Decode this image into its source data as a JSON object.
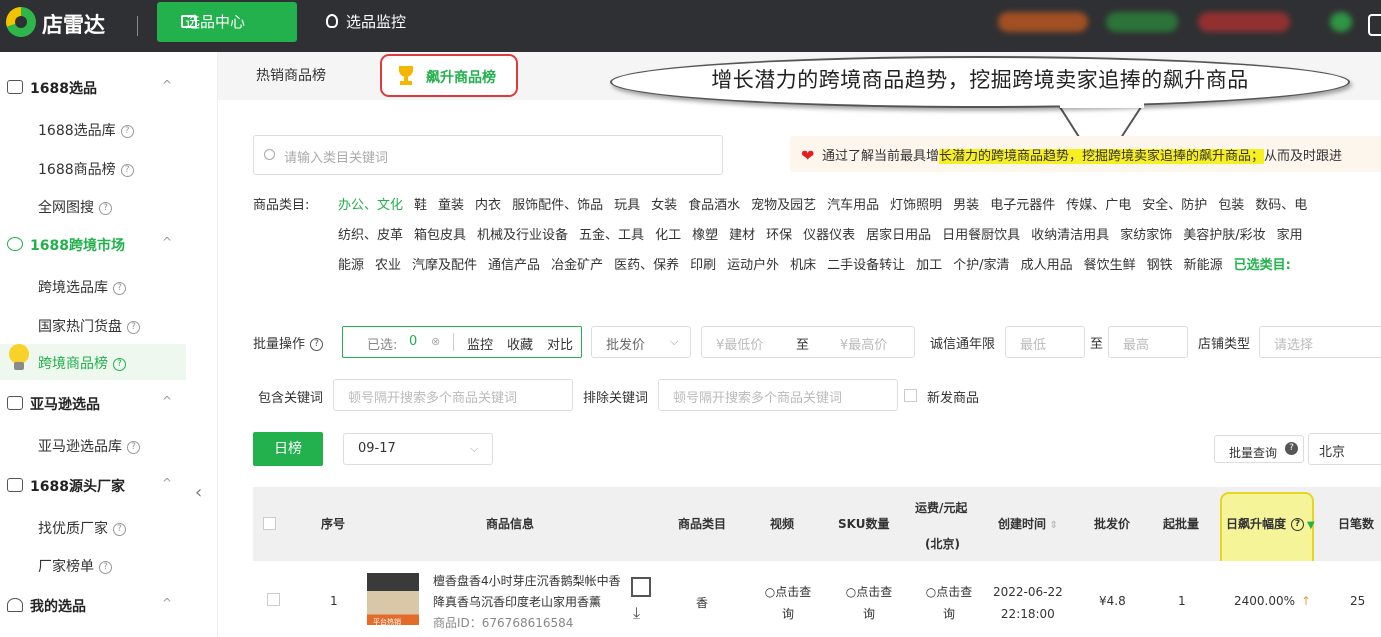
{
  "app": {
    "logo": "店雷达"
  },
  "topnav": {
    "selection_center": "选品中心",
    "monitor": "选品监控"
  },
  "sidebar": {
    "g1": "1688选品",
    "g1_items": [
      "1688选品库",
      "1688商品榜",
      "全网图搜"
    ],
    "g2": "1688跨境市场",
    "g2_items": [
      "跨境选品库",
      "国家热门货盘",
      "跨境商品榜"
    ],
    "g3": "亚马逊选品",
    "g3_items": [
      "亚马逊选品库"
    ],
    "g4": "1688源头厂家",
    "g4_items": [
      "找优质厂家",
      "厂家榜单"
    ],
    "g5": "我的选品",
    "q": "?",
    "caret": "^"
  },
  "tabs": {
    "hot": "热销商品榜",
    "rising": "飙升商品榜"
  },
  "callout": "增长潜力的跨境商品趋势，挖掘跨境卖家追捧的飙升商品",
  "search": {
    "placeholder": "请输入类目关键词"
  },
  "notice": {
    "pre": "通过了解当前最具增",
    "hl": "长潜力的跨境商品趋势，挖掘跨境卖家追捧的飙升商品；",
    "post": "从而及时跟进"
  },
  "categories": {
    "label": "商品类目:",
    "row1": [
      "办公、文化",
      "鞋",
      "童装",
      "内衣",
      "服饰配件、饰品",
      "玩具",
      "女装",
      "食品酒水",
      "宠物及园艺",
      "汽车用品",
      "灯饰照明",
      "男装",
      "电子元器件",
      "传媒、广电",
      "安全、防护",
      "包装",
      "数码、电"
    ],
    "row2": [
      "纺织、皮革",
      "箱包皮具",
      "机械及行业设备",
      "五金、工具",
      "化工",
      "橡塑",
      "建材",
      "环保",
      "仪器仪表",
      "居家日用品",
      "日用餐厨饮具",
      "收纳清洁用具",
      "家纺家饰",
      "美容护肤/彩妆",
      "家用"
    ],
    "row3": [
      "能源",
      "农业",
      "汽摩及配件",
      "通信产品",
      "冶金矿产",
      "医药、保养",
      "印刷",
      "运动户外",
      "机床",
      "二手设备转让",
      "加工",
      "个护/家清",
      "成人用品",
      "餐饮生鲜",
      "钢铁",
      "新能源"
    ],
    "selected_label": "已选类目:"
  },
  "filters": {
    "batch_label": "批量操作",
    "selected": "已选:",
    "selected_count": "0",
    "monitor": "监控",
    "collect": "收藏",
    "compare": "对比",
    "price_type": "批发价",
    "min_price": "¥最低价",
    "to": "至",
    "max_price": "¥最高价",
    "years_label": "诚信通年限",
    "min": "最低",
    "max": "最高",
    "shop_type": "店铺类型",
    "choose": "请选择",
    "include_kw": "包含关键词",
    "exclude_kw": "排除关键词",
    "kw_placeholder": "顿号隔开搜索多个商品关键词",
    "new_goods": "新发商品"
  },
  "list": {
    "day_btn": "日榜",
    "date": "09-17",
    "batch_query": "批量查询",
    "region": "北京"
  },
  "table": {
    "headers": {
      "index": "序号",
      "info": "商品信息",
      "category": "商品类目",
      "video": "视频",
      "sku": "SKU数量",
      "freight1": "运费/元起",
      "freight2": "(北京)",
      "created": "创建时间",
      "price": "批发价",
      "moq": "起批量",
      "rise": "日飙升幅度",
      "orders": "日笔数"
    },
    "rows": [
      {
        "index": "1",
        "title1": "檀香盘香4小时芽庄沉香鹅梨帐中香",
        "title2": "降真香乌沉香印度老山家用香薰",
        "id": "商品ID：676768616584",
        "thumb_tag": "平台热销",
        "category": "香",
        "query1": "点击查",
        "query2": "询",
        "date": "2022-06-22",
        "time": "22:18:00",
        "price": "¥4.8",
        "moq": "1",
        "rise": "2400.00%",
        "orders": "25"
      }
    ]
  }
}
